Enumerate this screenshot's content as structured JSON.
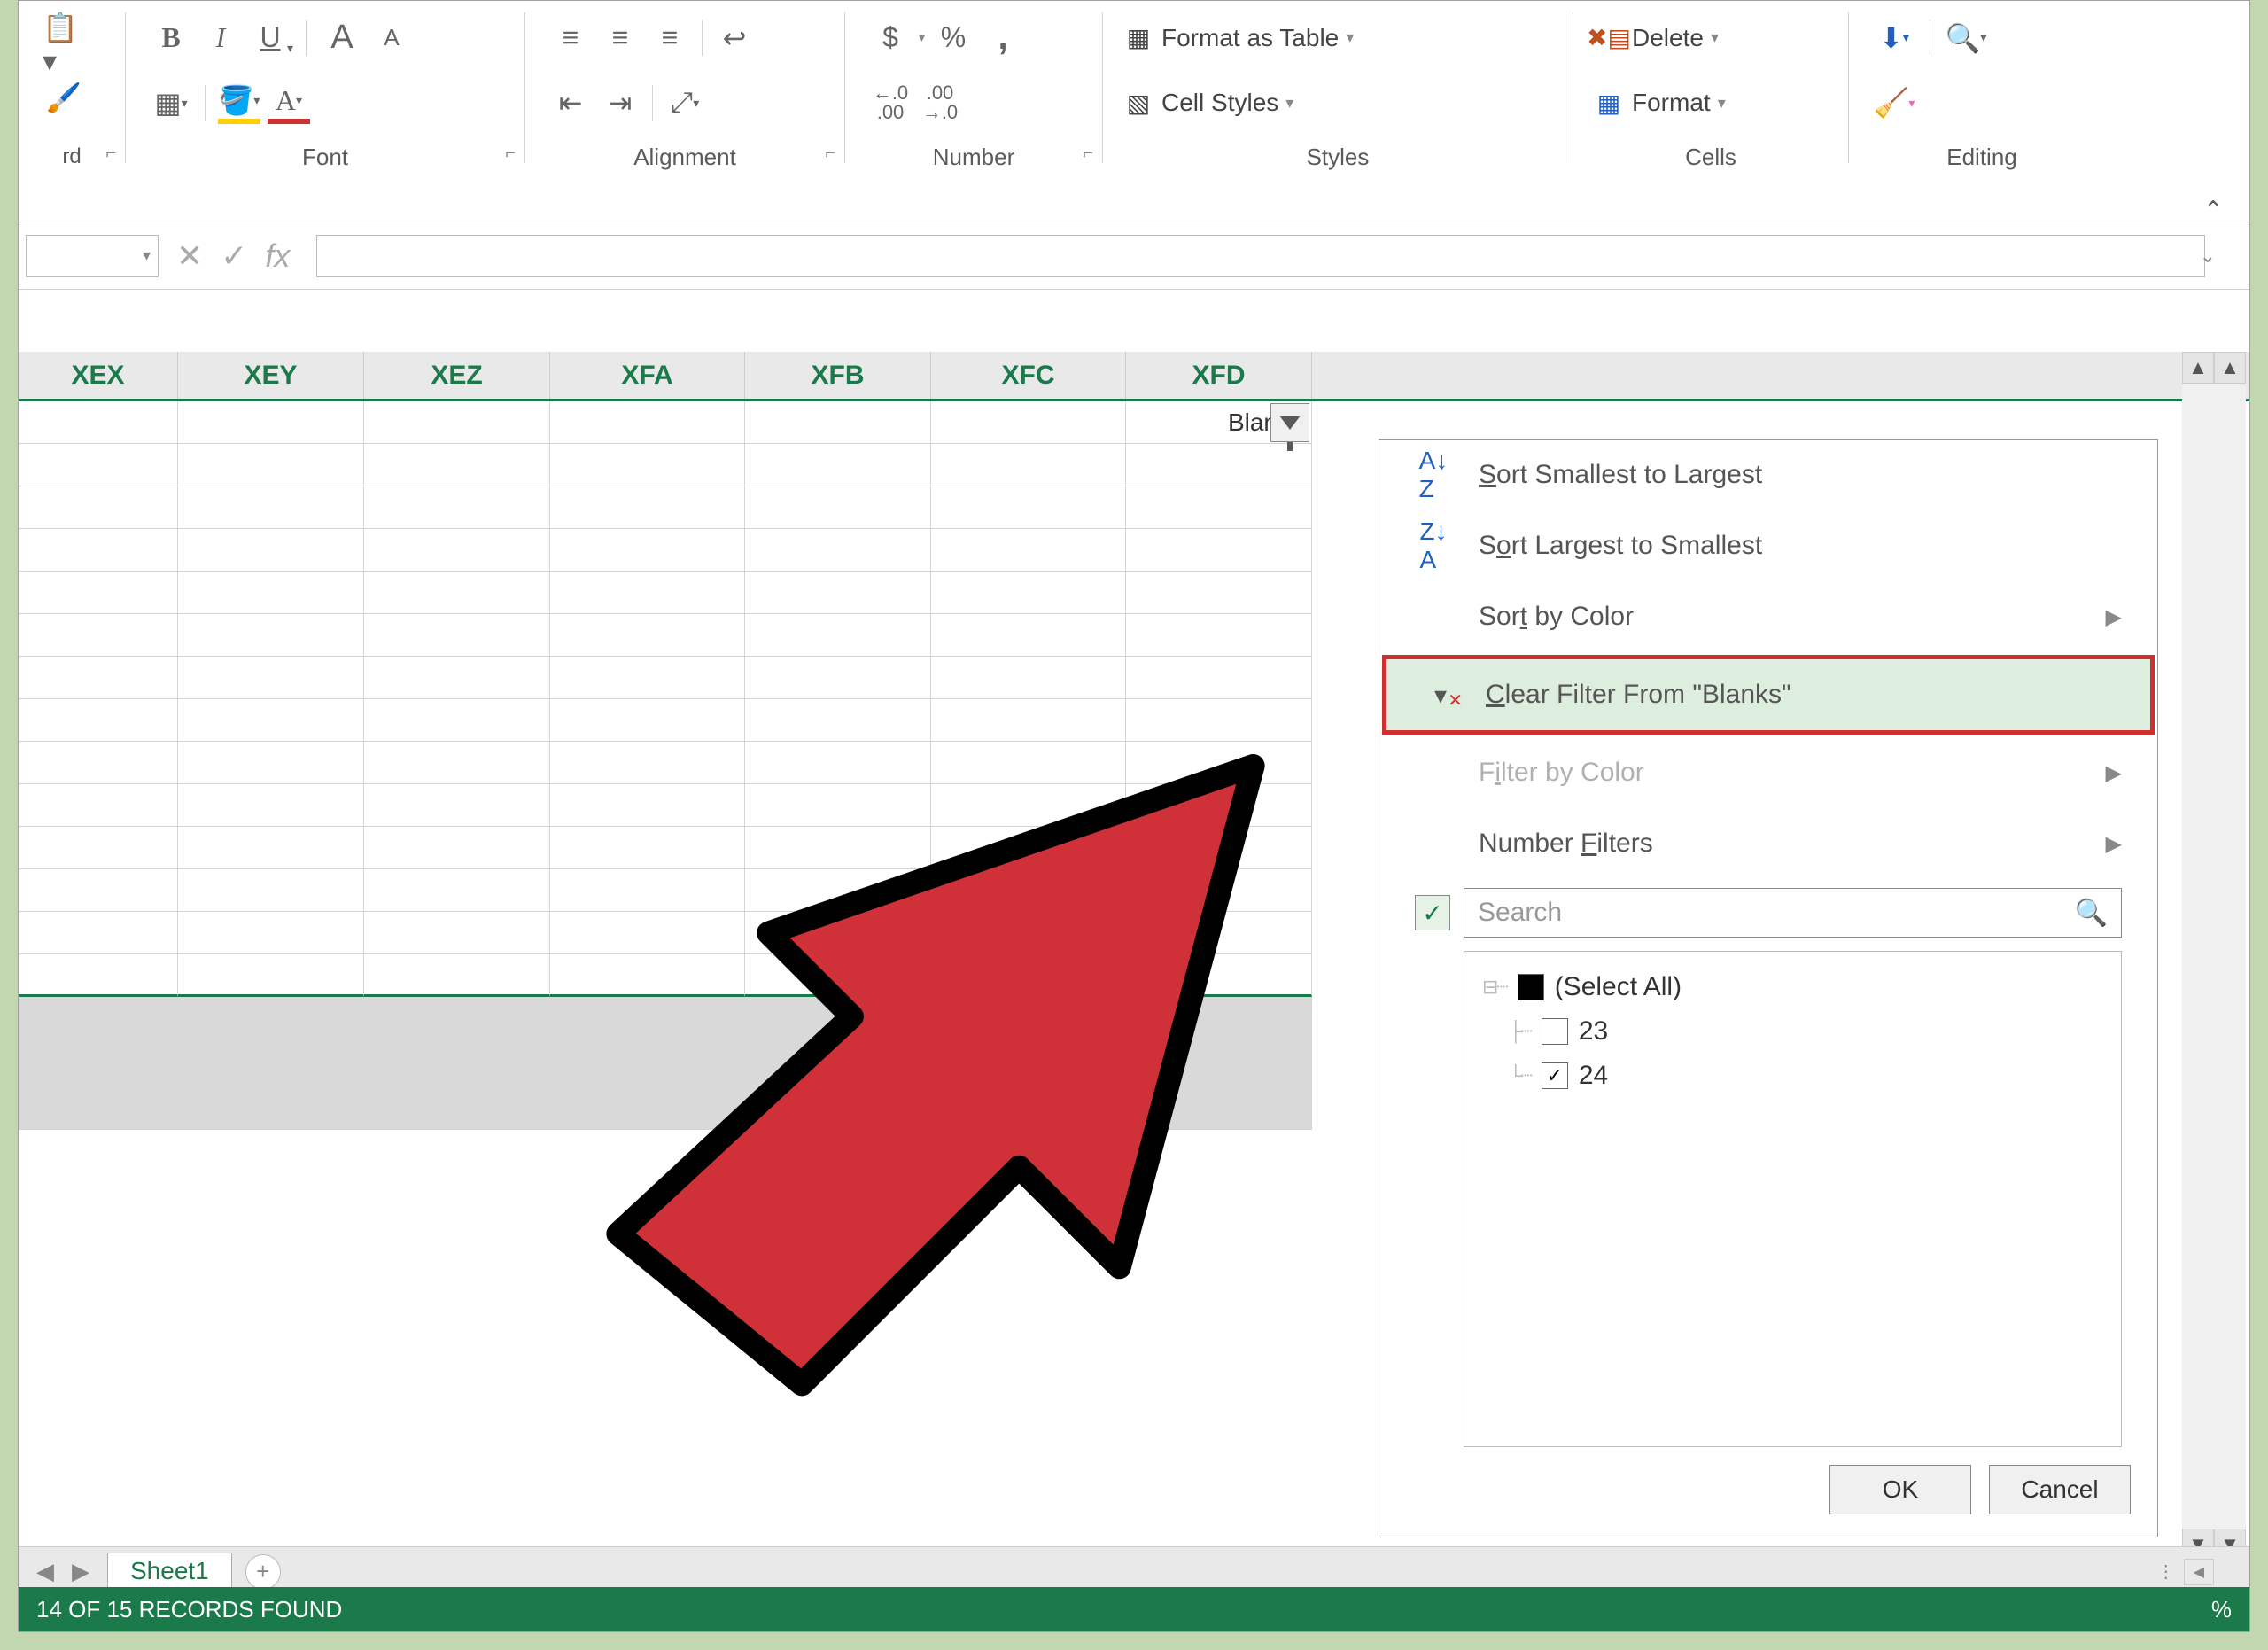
{
  "ribbon": {
    "font": {
      "bold": "B",
      "italic": "I",
      "underline": "U",
      "grow": "A",
      "shrink": "A",
      "group_label": "Font"
    },
    "alignment": {
      "group_label": "Alignment"
    },
    "number": {
      "currency": "$",
      "percent": "%",
      "comma": ",",
      "inc_dec_label1": ".0",
      "inc_dec_label2": ".00",
      "group_label": "Number"
    },
    "styles": {
      "format_as_table": "Format as Table",
      "cell_styles": "Cell Styles",
      "group_label": "Styles"
    },
    "cells": {
      "delete": "Delete",
      "format": "Format",
      "group_label": "Cells"
    },
    "editing": {
      "group_label": "Editing"
    }
  },
  "formula_bar": {
    "fx": "fx"
  },
  "columns": [
    "XEX",
    "XEY",
    "XEZ",
    "XFA",
    "XFB",
    "XFC",
    "XFD"
  ],
  "cell_values": {
    "xfd1": "Blanks"
  },
  "dropdown": {
    "sort_asc": "Sort Smallest to Largest",
    "sort_desc": "Sort Largest to Smallest",
    "sort_color": "Sort by Color",
    "clear_filter": "Clear Filter From \"Blanks\"",
    "filter_color": "Filter by Color",
    "number_filters": "Number Filters",
    "search_placeholder": "Search",
    "tree": {
      "select_all": "(Select All)",
      "item1": "23",
      "item2": "24"
    },
    "ok": "OK",
    "cancel": "Cancel"
  },
  "sheet": {
    "tab1": "Sheet1"
  },
  "status": {
    "records": "14 OF 15 RECORDS FOUND",
    "zoom_suffix": "%"
  }
}
